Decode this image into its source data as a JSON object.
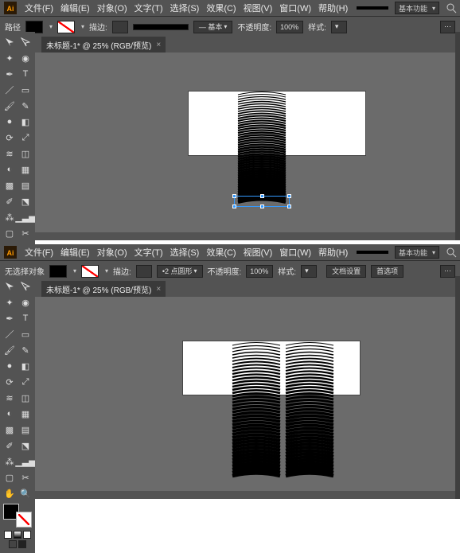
{
  "app": {
    "icon": "Ai"
  },
  "menus": {
    "file": "文件(F)",
    "edit": "编辑(E)",
    "object": "对象(O)",
    "type": "文字(T)",
    "select": "选择(S)",
    "effect": "效果(C)",
    "view": "视图(V)",
    "window": "窗口(W)",
    "help": "帮助(H)"
  },
  "menubar_right": {
    "layout_label": "基本功能"
  },
  "tab": {
    "title": "未标题-1* @ 25% (RGB/预览)",
    "close": "×"
  },
  "options_top": {
    "path_label": "路径",
    "fill_value": "#000000",
    "stroke_value": "无",
    "stroke_label": "描边:",
    "stroke_cap_label": "— 基本",
    "opacity_label": "不透明度:",
    "opacity_value": "100%",
    "style_label": "样式:",
    "more": "▾"
  },
  "options_bottom": {
    "noselect_label": "无选择对象",
    "fill_value": "#000000",
    "stroke_value": "无",
    "stroke_label": "描边:",
    "roundrect_label": "2 点圆形",
    "opacity_label": "不透明度:",
    "opacity_value": "100%",
    "style_label": "样式:",
    "docsetup_label": "文档设置",
    "prefs_label": "首选项"
  },
  "tools": {
    "row0": [
      "selection",
      "direct-selection"
    ],
    "row1": [
      "magic-wand",
      "lasso"
    ],
    "row2": [
      "pen",
      "type"
    ],
    "row3": [
      "line",
      "rectangle"
    ],
    "row4": [
      "paintbrush",
      "pencil"
    ],
    "row5": [
      "blob-brush",
      "eraser"
    ],
    "row6": [
      "rotate",
      "scale"
    ],
    "row7": [
      "width",
      "free-transform"
    ],
    "row8": [
      "shape-builder",
      "perspective"
    ],
    "row9": [
      "mesh",
      "gradient"
    ],
    "row10": [
      "eyedropper",
      "blend"
    ],
    "row11": [
      "symbol-spray",
      "column-graph"
    ],
    "row12": [
      "artboard",
      "slice"
    ],
    "row13": [
      "hand",
      "zoom"
    ]
  },
  "color": {
    "fg": "#000000",
    "bg": "none"
  },
  "canvas": {
    "artboard_bg": "#ffffff",
    "workarea_bg": "#6b6b6b"
  },
  "chart_data": null
}
